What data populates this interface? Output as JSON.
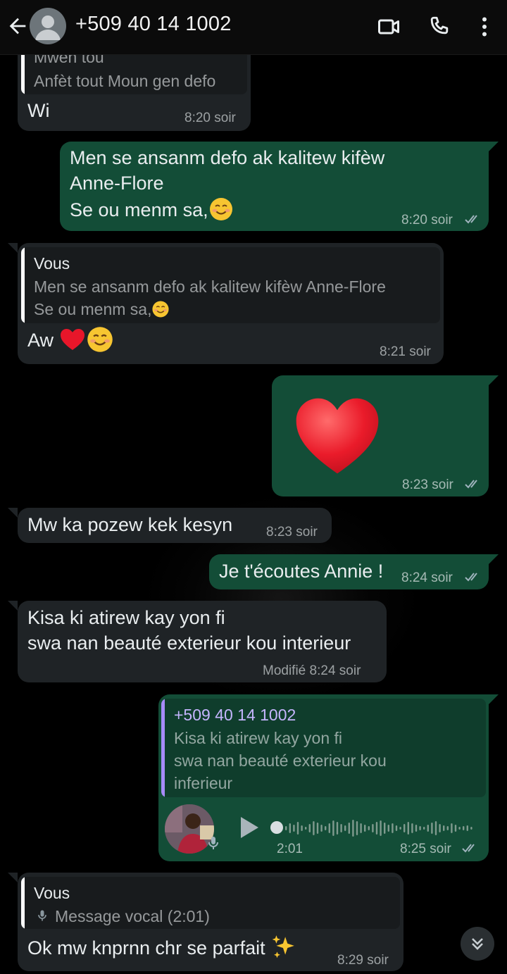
{
  "header": {
    "contact_name": "+509 40 14 1002",
    "icons": [
      "back-arrow-icon",
      "video-call-icon",
      "voice-call-icon",
      "more-options-icon"
    ]
  },
  "colors": {
    "incoming_bubble": "#1f2326",
    "outgoing_bubble": "#134d37",
    "quote_you": "#ffffff",
    "quote_contact": "#a78bfa",
    "tick": "#9fb3bd"
  },
  "messages": {
    "m1": {
      "quote_text_1": "Mwen tou",
      "quote_text_2": "Anfèt tout Moun gen defo",
      "text": "Wi",
      "time": "8:20 soir"
    },
    "m2": {
      "line1": "Men se ansanm defo ak kalitew kifèw",
      "line2": "Anne-Flore",
      "line3": "Se ou menm sa,",
      "time": "8:20 soir"
    },
    "m3": {
      "quote_name": "Vous",
      "quote_line1": "Men se ansanm defo ak kalitew kifèw Anne-Flore",
      "quote_line2": "Se ou menm sa,",
      "text": "Aw",
      "time": "8:21 soir"
    },
    "m4": {
      "time": "8:23 soir"
    },
    "m5": {
      "text": "Mw ka pozew kek kesyn",
      "time": "8:23 soir"
    },
    "m6": {
      "text": "Je t'écoutes Annie !",
      "time": "8:24 soir"
    },
    "m7": {
      "line1": "Kisa ki atirew kay yon fi",
      "line2": "swa nan beauté exterieur kou interieur",
      "edited_time": "Modifié 8:24 soir"
    },
    "m8": {
      "quote_name": "+509 40 14 1002",
      "quote_line1": "Kisa ki atirew kay yon fi",
      "quote_line2": "swa nan beauté exterieur kou",
      "quote_line3": "inferieur",
      "duration": "2:01",
      "time": "8:25 soir"
    },
    "m9": {
      "quote_name": "Vous",
      "quote_text": "Message vocal (2:01)",
      "text": "Ok mw knprnn chr se parfait",
      "time": "8:29 soir"
    }
  }
}
